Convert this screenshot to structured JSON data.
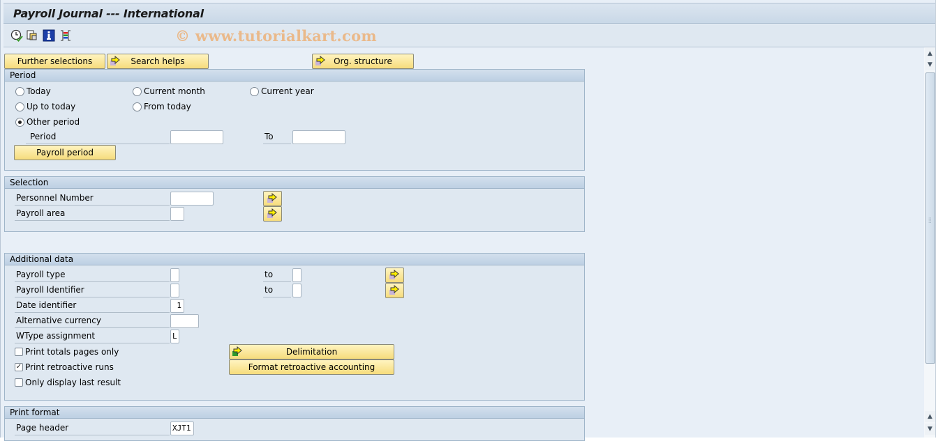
{
  "window": {
    "title": "Payroll Journal --- International",
    "watermark": "© www.tutorialkart.com"
  },
  "toolbar": {
    "icons": [
      "execute-clock-icon",
      "variants-icon",
      "info-icon",
      "selection-screen-icon"
    ]
  },
  "top_buttons": {
    "further_selections": "Further selections",
    "search_helps": "Search helps",
    "org_structure": "Org. structure"
  },
  "period": {
    "header": "Period",
    "options": {
      "today": "Today",
      "current_month": "Current month",
      "current_year": "Current year",
      "up_to_today": "Up to today",
      "from_today": "From today",
      "other_period": "Other period"
    },
    "selected": "other_period",
    "period_label": "Period",
    "period_from": "",
    "to_label": "To",
    "period_to": "",
    "payroll_period_button": "Payroll period"
  },
  "selection": {
    "header": "Selection",
    "personnel_number_label": "Personnel Number",
    "personnel_number_value": "",
    "payroll_area_label": "Payroll area",
    "payroll_area_value": ""
  },
  "additional": {
    "header": "Additional data",
    "payroll_type_label": "Payroll type",
    "payroll_type_from": "",
    "payroll_type_to_label": "to",
    "payroll_type_to": "",
    "payroll_identifier_label": "Payroll Identifier",
    "payroll_identifier_from": "",
    "payroll_identifier_to_label": "to",
    "payroll_identifier_to": "",
    "date_identifier_label": "Date identifier",
    "date_identifier_value": "1",
    "alt_currency_label": "Alternative currency",
    "alt_currency_value": "",
    "wtype_label": "WType assignment",
    "wtype_value": "L",
    "print_totals_label": "Print totals pages only",
    "print_totals_checked": false,
    "print_retro_label": "Print retroactive runs",
    "print_retro_checked": true,
    "only_last_label": "Only display last result",
    "only_last_checked": false,
    "delimitation_button": "Delimitation",
    "format_retro_button": "Format retroactive accounting"
  },
  "print_format": {
    "header": "Print format",
    "page_header_label": "Page header",
    "page_header_value": "XJT1"
  },
  "colors": {
    "button_yellow": "#f6dc7c",
    "group_header": "#bdd0e3",
    "background": "#e8eff7"
  }
}
